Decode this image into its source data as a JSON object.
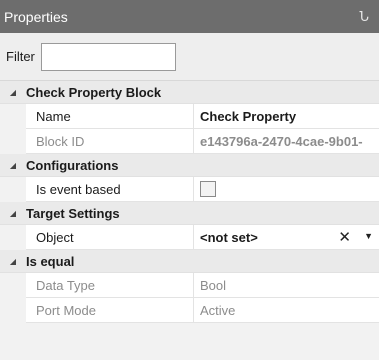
{
  "panel": {
    "title": "Properties",
    "pin_glyph": "Ն"
  },
  "filter": {
    "label": "Filter",
    "value": "",
    "placeholder": ""
  },
  "icons": {
    "expand": "expanded-triangle-icon",
    "pin": "pin-icon",
    "clear": "clear-x-icon",
    "dropdown": "dropdown-caret-icon"
  },
  "categories": {
    "check_property_block": {
      "label": "Check Property Block",
      "rows": {
        "name": {
          "label": "Name",
          "value": "Check Property"
        },
        "block_id": {
          "label": "Block ID",
          "value": "e143796a-2470-4cae-9b01-"
        }
      }
    },
    "configurations": {
      "label": "Configurations",
      "rows": {
        "is_event_based": {
          "label": "Is event based",
          "checked": false
        }
      }
    },
    "target_settings": {
      "label": "Target Settings",
      "rows": {
        "object": {
          "label": "Object",
          "value": "<not set>",
          "clear_glyph": "✕",
          "dropdown_glyph": "▼"
        }
      }
    },
    "is_equal": {
      "label": "Is equal",
      "rows": {
        "data_type": {
          "label": "Data Type",
          "value": "Bool"
        },
        "port_mode": {
          "label": "Port Mode",
          "value": "Active"
        }
      }
    }
  },
  "expand_glyph": "◢"
}
